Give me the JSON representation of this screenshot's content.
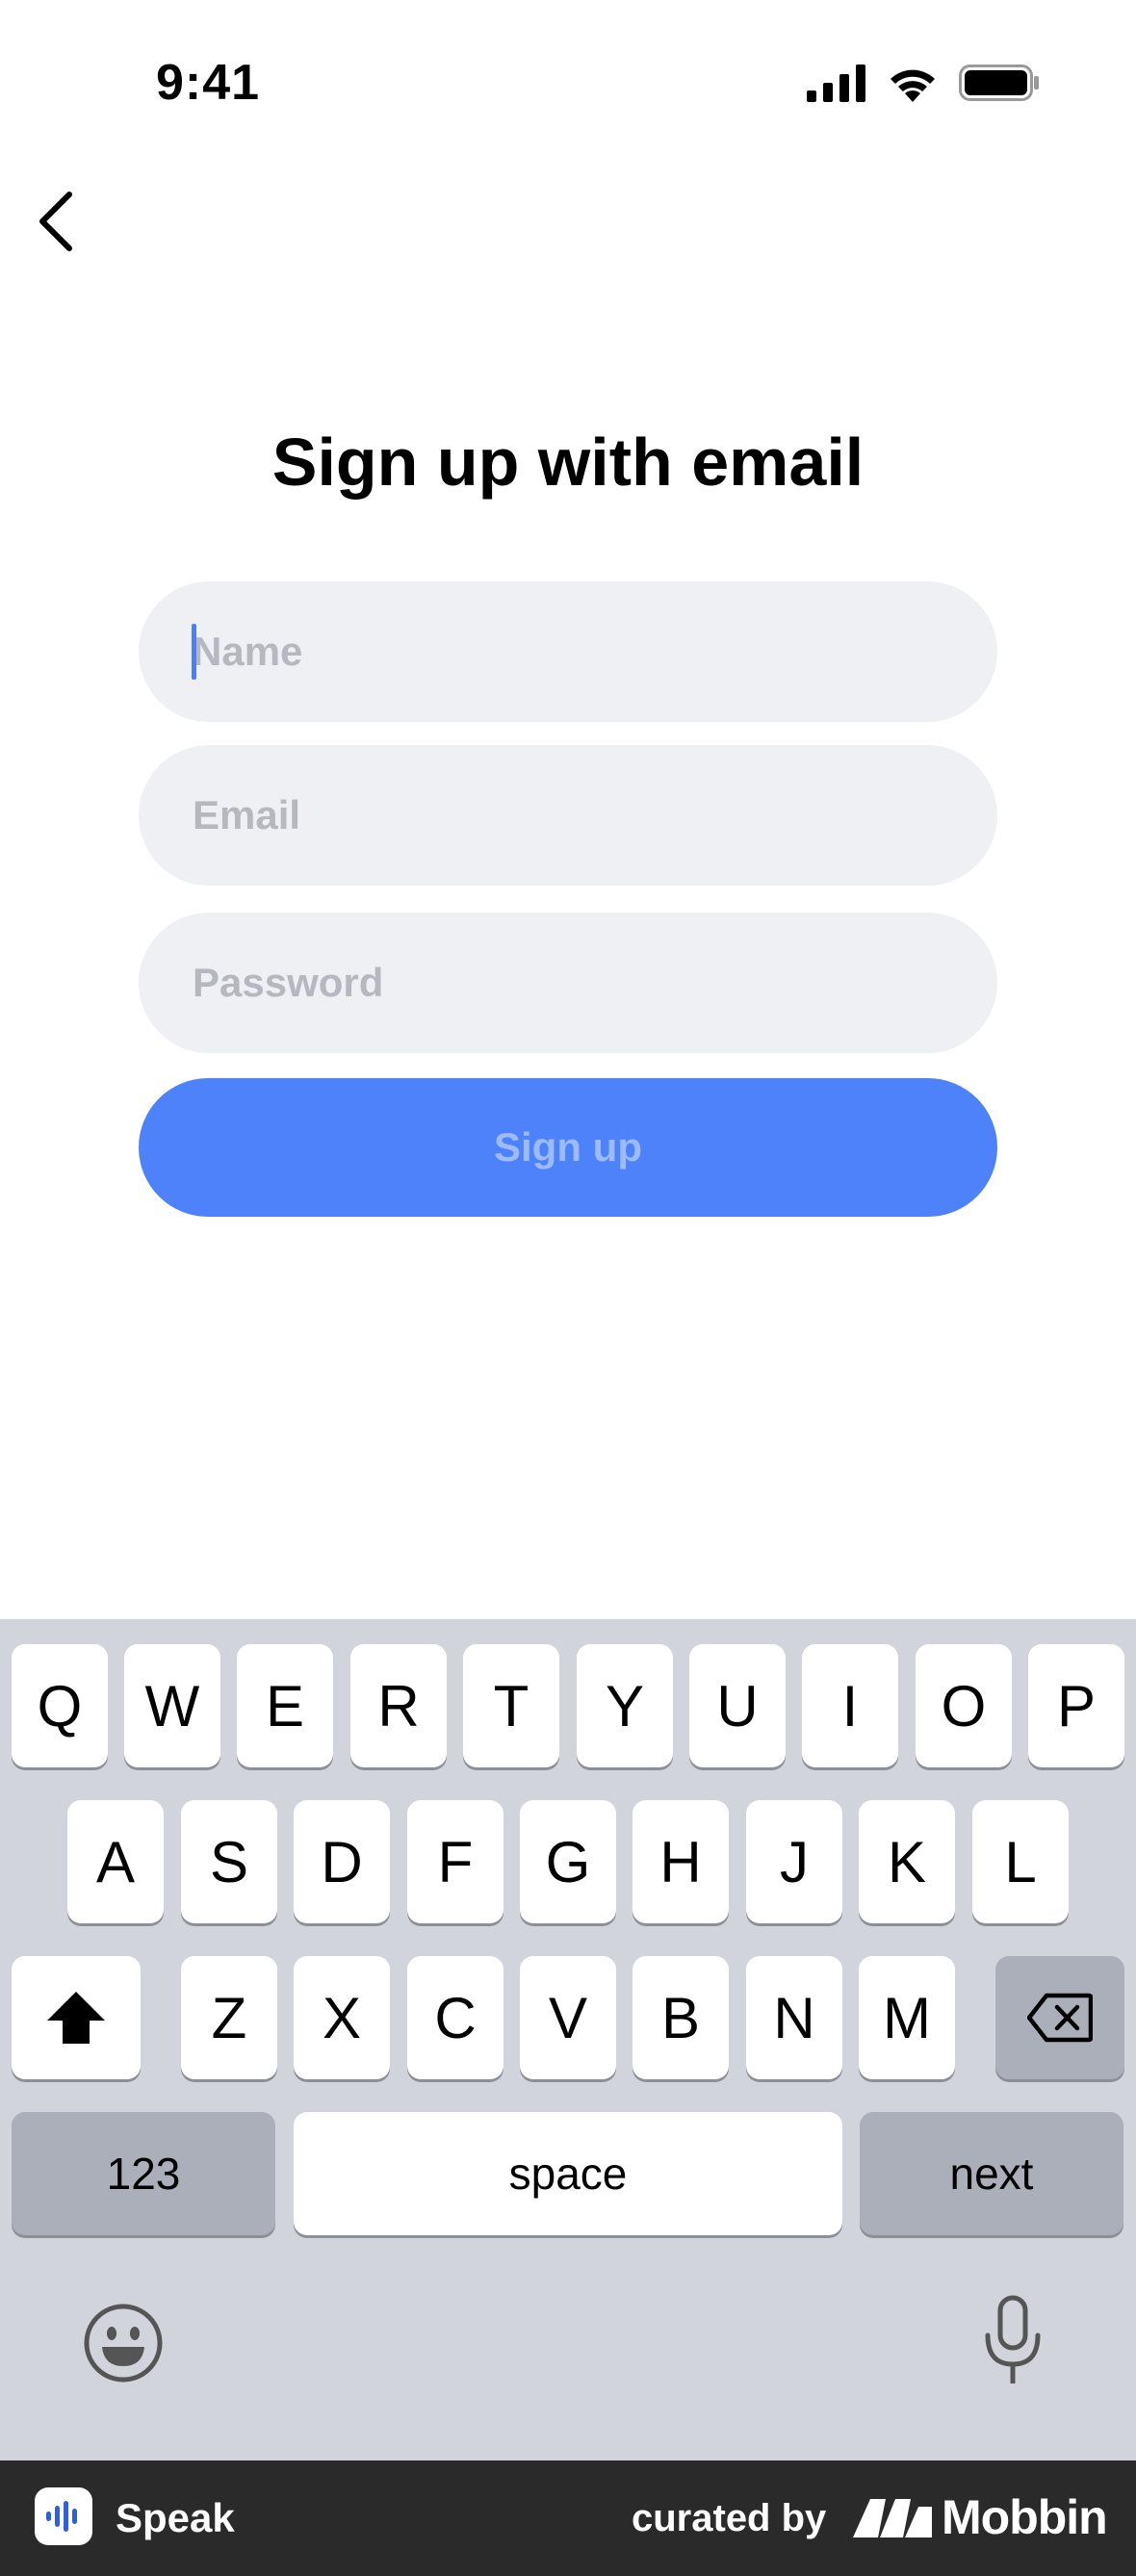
{
  "status_bar": {
    "time": "9:41",
    "icons": [
      "cellular-signal-icon",
      "wifi-icon",
      "battery-icon"
    ]
  },
  "nav": {
    "back_icon": "chevron-left-icon"
  },
  "title": "Sign up with email",
  "form": {
    "name_placeholder": "Name",
    "email_placeholder": "Email",
    "password_placeholder": "Password",
    "name_value": "",
    "email_value": "",
    "password_value": "",
    "submit_label": "Sign up",
    "colors": {
      "field_bg": "#eff0f4",
      "button_bg": "#4d82fa",
      "button_text": "#9dbafa",
      "caret": "#4a7ff5"
    }
  },
  "keyboard": {
    "row1": [
      "Q",
      "W",
      "E",
      "R",
      "T",
      "Y",
      "U",
      "I",
      "O",
      "P"
    ],
    "row2": [
      "A",
      "S",
      "D",
      "F",
      "G",
      "H",
      "J",
      "K",
      "L"
    ],
    "row3": [
      "Z",
      "X",
      "C",
      "V",
      "B",
      "N",
      "M"
    ],
    "shift_icon": "shift-icon",
    "delete_icon": "backspace-icon",
    "numbers_label": "123",
    "space_label": "space",
    "next_label": "next",
    "emoji_icon": "emoji-icon",
    "mic_icon": "microphone-icon"
  },
  "footer": {
    "app_name": "Speak",
    "curated_by": "curated by",
    "brand": "Mobbin"
  }
}
